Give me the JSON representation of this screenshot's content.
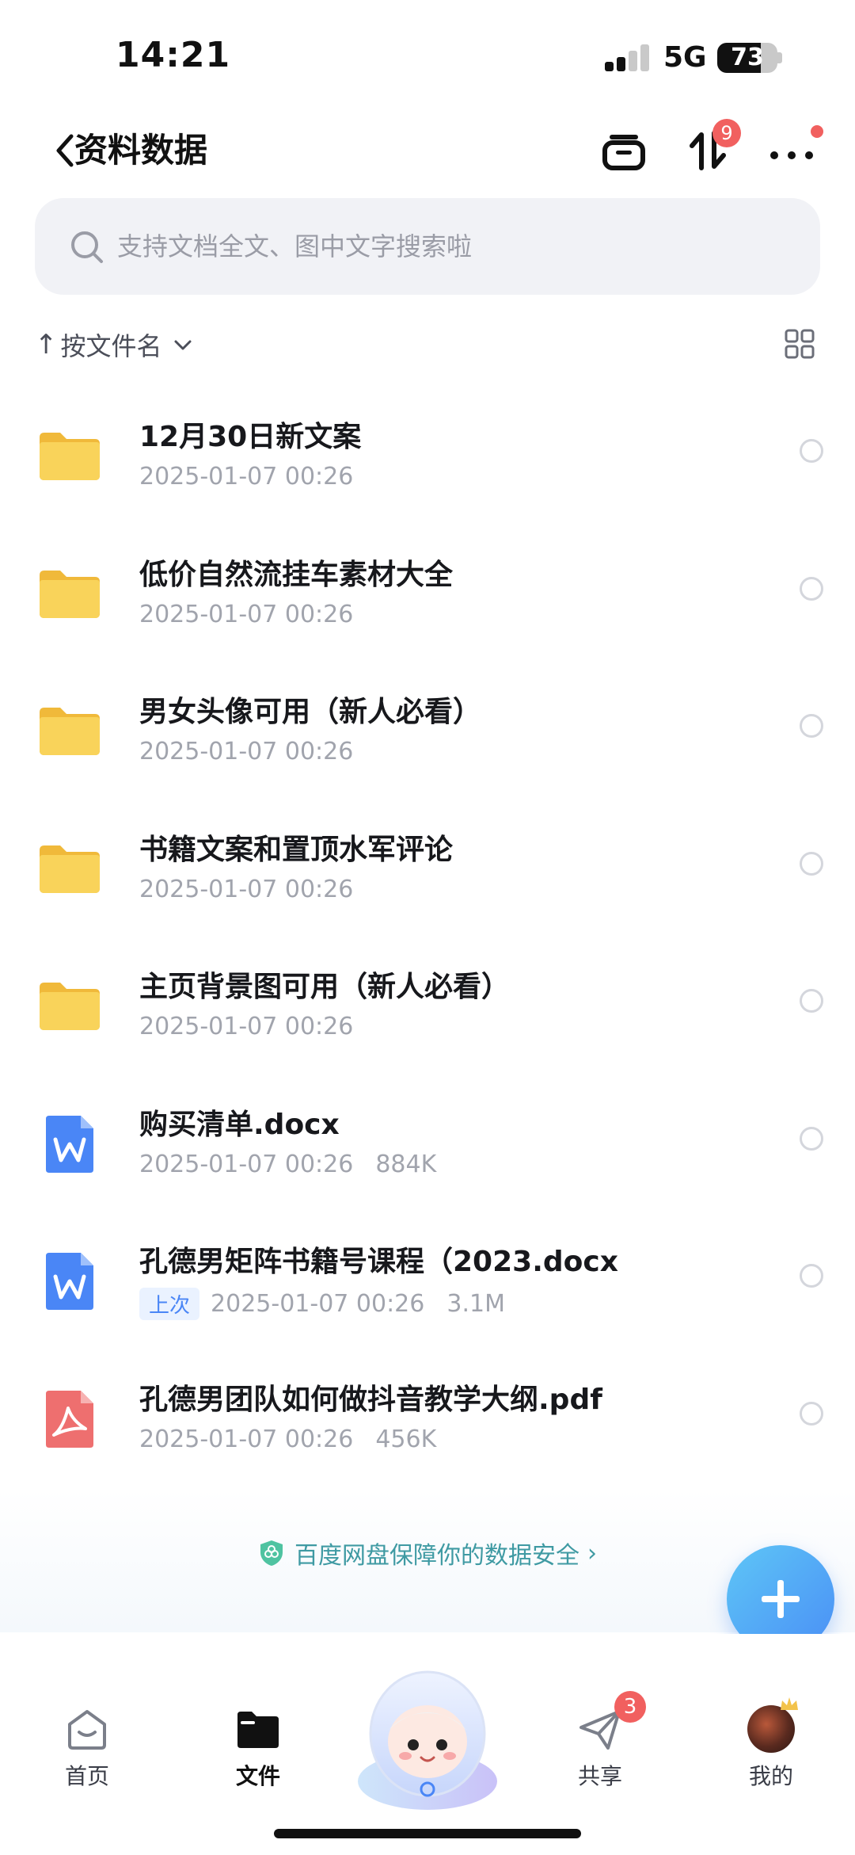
{
  "status_bar": {
    "time": "14:21",
    "network": "5G",
    "battery": "73",
    "battery_level": 0.73
  },
  "nav": {
    "title": "资料数据",
    "transfer_badge": "9"
  },
  "search": {
    "placeholder": "支持文档全文、图中文字搜索啦"
  },
  "sort": {
    "arrow": "↑",
    "label": "按文件名"
  },
  "files": [
    {
      "name": "12月30日新文案",
      "date": "2025-01-07 00:26",
      "size": "",
      "tag": "",
      "type": "folder",
      "icon": "folder-icon"
    },
    {
      "name": "低价自然流挂车素材大全",
      "date": "2025-01-07 00:26",
      "size": "",
      "tag": "",
      "type": "folder",
      "icon": "folder-icon"
    },
    {
      "name": "男女头像可用（新人必看）",
      "date": "2025-01-07 00:26",
      "size": "",
      "tag": "",
      "type": "folder",
      "icon": "folder-icon"
    },
    {
      "name": "书籍文案和置顶水军评论",
      "date": "2025-01-07 00:26",
      "size": "",
      "tag": "",
      "type": "folder",
      "icon": "folder-icon"
    },
    {
      "name": "主页背景图可用（新人必看）",
      "date": "2025-01-07 00:26",
      "size": "",
      "tag": "",
      "type": "folder",
      "icon": "folder-icon"
    },
    {
      "name": "购买清单.docx",
      "date": "2025-01-07 00:26",
      "size": "884K",
      "tag": "",
      "type": "docx",
      "icon": "word-doc-icon"
    },
    {
      "name": "孔德男矩阵书籍号课程（2023.docx",
      "date": "2025-01-07 00:26",
      "size": "3.1M",
      "tag": "上次",
      "type": "docx",
      "icon": "word-doc-icon"
    },
    {
      "name": "孔德男团队如何做抖音教学大纲.pdf",
      "date": "2025-01-07 00:26",
      "size": "456K",
      "tag": "",
      "type": "pdf",
      "icon": "pdf-icon"
    }
  ],
  "security_banner": {
    "text": "百度网盘保障你的数据安全",
    "chevron": "›"
  },
  "tabs": [
    {
      "label": "首页",
      "icon": "home-icon"
    },
    {
      "label": "文件",
      "icon": "folder-tab-icon"
    },
    {
      "label": "共享",
      "icon": "share-plane-icon",
      "badge": "3"
    },
    {
      "label": "我的",
      "icon": "avatar"
    }
  ],
  "colors": {
    "accent": "#4a8ff5",
    "badge": "#f1605f",
    "folder": "#f7c948",
    "word": "#4a86f6",
    "pdf": "#ee6f6f",
    "security_text": "#3f9aa3"
  }
}
